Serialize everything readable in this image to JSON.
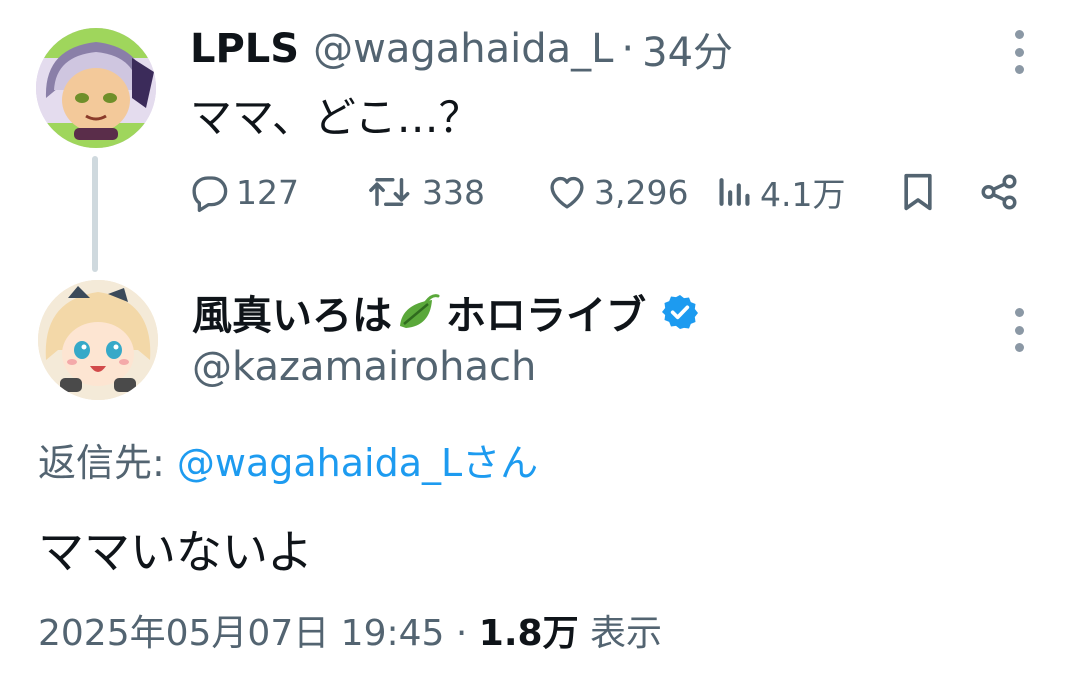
{
  "parent_tweet": {
    "display_name": "LPLS",
    "handle": "@wagahaida_L",
    "separator": "·",
    "time_ago": "34分",
    "text": "ママ、どこ…？",
    "reply_count": "127",
    "retweet_count": "338",
    "like_count": "3,296",
    "view_count": "4.1万",
    "icons": [
      "avatar",
      "reply-icon",
      "retweet-icon",
      "like-icon",
      "views-icon",
      "bookmark-icon",
      "share-icon",
      "more-icon"
    ]
  },
  "main_tweet": {
    "display_name": "風真いろは",
    "display_name_suffix": "ホロライブ",
    "handle": "@kazamairohach",
    "reply_to_label": "返信先: ",
    "reply_to_mention": "@wagahaida_Lさん",
    "text": "ママいないよ",
    "timestamp": "2025年05月07日 19:45",
    "separator": "·",
    "views": "1.8万",
    "views_label": "表示",
    "icons": [
      "avatar",
      "leaf-emoji-icon",
      "verified-badge-icon",
      "more-icon"
    ]
  },
  "colors": {
    "text_primary": "#0f1419",
    "text_secondary": "#536471",
    "accent_blue": "#1d9bf0",
    "thread_line": "#cfd9de"
  }
}
